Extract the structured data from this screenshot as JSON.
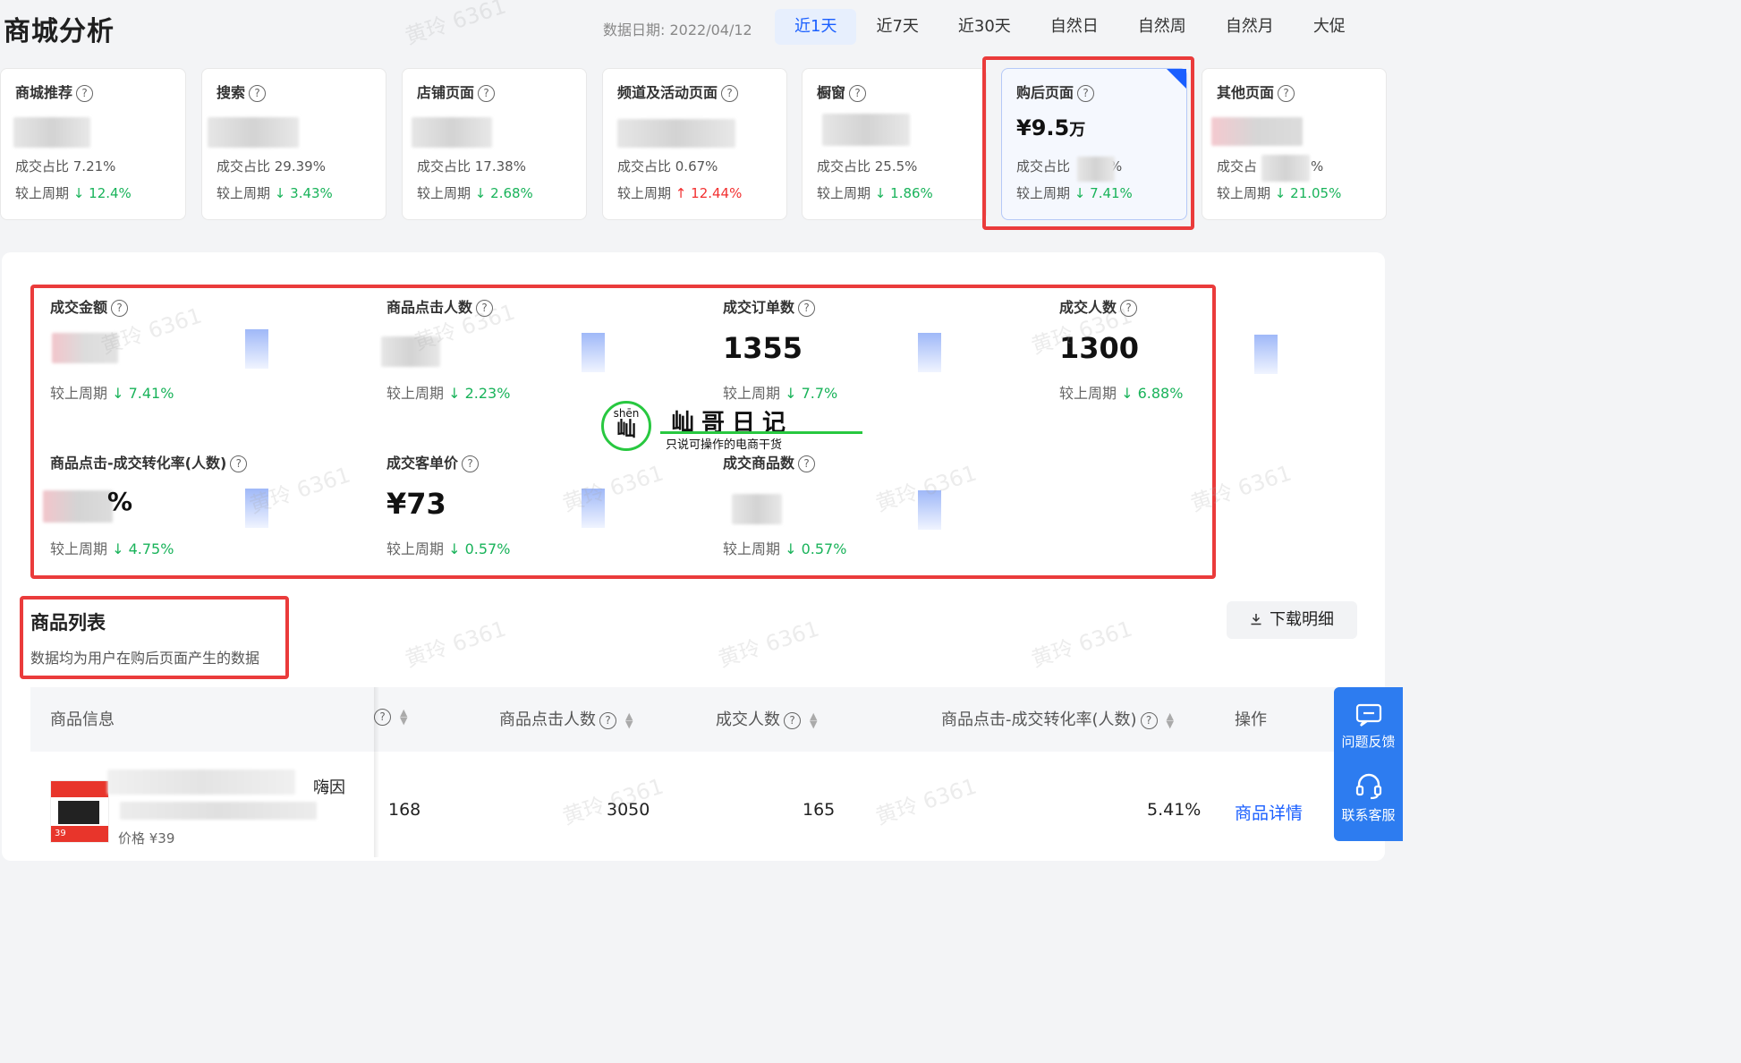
{
  "header": {
    "title": "商城分析",
    "date_label": "数据日期: 2022/04/12",
    "ranges": [
      "近1天",
      "近7天",
      "近30天",
      "自然日",
      "自然周",
      "自然月",
      "大促"
    ],
    "active_range": "近1天"
  },
  "source_cards": [
    {
      "title": "商城推荐",
      "share": "成交占比 7.21%",
      "cmp_label": "较上周期",
      "cmp_arrow": "↓",
      "cmp_value": "12.4%",
      "trend": "down"
    },
    {
      "title": "搜索",
      "share": "成交占比 29.39%",
      "cmp_label": "较上周期",
      "cmp_arrow": "↓",
      "cmp_value": "3.43%",
      "trend": "down"
    },
    {
      "title": "店铺页面",
      "share": "成交占比 17.38%",
      "cmp_label": "较上周期",
      "cmp_arrow": "↓",
      "cmp_value": "2.68%",
      "trend": "down"
    },
    {
      "title": "频道及活动页面",
      "share": "成交占比 0.67%",
      "cmp_label": "较上周期",
      "cmp_arrow": "↑",
      "cmp_value": "12.44%",
      "trend": "up"
    },
    {
      "title": "橱窗",
      "share": "成交占比 25.5%",
      "cmp_label": "较上周期",
      "cmp_arrow": "↓",
      "cmp_value": "1.86%",
      "trend": "down"
    },
    {
      "title": "购后页面",
      "amount": "¥9.5",
      "amount_unit": "万",
      "share": "成交占比",
      "share_tail": "%",
      "cmp_label": "较上周期",
      "cmp_arrow": "↓",
      "cmp_value": "7.41%",
      "trend": "down",
      "selected": true
    },
    {
      "title": "其他页面",
      "share": "成交占",
      "share_tail": "%",
      "cmp_label": "较上周期",
      "cmp_arrow": "↓",
      "cmp_value": "21.05%",
      "trend": "down"
    }
  ],
  "metrics": [
    {
      "label": "成交金额",
      "value": "",
      "cmp_label": "较上周期",
      "cmp_arrow": "↓",
      "cmp_value": "7.41%"
    },
    {
      "label": "商品点击人数",
      "value": "",
      "cmp_label": "较上周期",
      "cmp_arrow": "↓",
      "cmp_value": "2.23%"
    },
    {
      "label": "成交订单数",
      "value": "1355",
      "cmp_label": "较上周期",
      "cmp_arrow": "↓",
      "cmp_value": "7.7%"
    },
    {
      "label": "成交人数",
      "value": "1300",
      "cmp_label": "较上周期",
      "cmp_arrow": "↓",
      "cmp_value": "6.88%"
    },
    {
      "label": "商品点击-成交转化率(人数)",
      "value": "%",
      "cmp_label": "较上周期",
      "cmp_arrow": "↓",
      "cmp_value": "4.75%"
    },
    {
      "label": "成交客单价",
      "value": "¥73",
      "cmp_label": "较上周期",
      "cmp_arrow": "↓",
      "cmp_value": "0.57%"
    },
    {
      "label": "成交商品数",
      "value": "",
      "cmp_label": "较上周期",
      "cmp_arrow": "↓",
      "cmp_value": "0.57%"
    }
  ],
  "logo": {
    "pinyin": "shēn",
    "char": "屾",
    "name": "屾哥日记",
    "slogan": "只说可操作的电商干货"
  },
  "product_list": {
    "title": "商品列表",
    "desc": "数据均为用户在购后页面产生的数据",
    "download_label": "下载明细",
    "columns": [
      "商品信息",
      "商品点击人数",
      "成交人数",
      "商品点击-成交转化率(人数)",
      "操作"
    ],
    "rows": [
      {
        "name_tail": "嗨因",
        "price": "价格 ¥39",
        "col1": "168",
        "clicks": "3050",
        "buyers": "165",
        "rate": "5.41%",
        "action": "商品详情",
        "thumb_text": "39"
      }
    ]
  },
  "float_panel": {
    "feedback_label": "问题反馈",
    "service_label": "联系客服"
  },
  "watermark_text": "黄玲 6361",
  "colors": {
    "accent": "#1a5fff",
    "down": "#19b35a",
    "up": "#f23030",
    "highlight_box": "#ea3b3b"
  }
}
